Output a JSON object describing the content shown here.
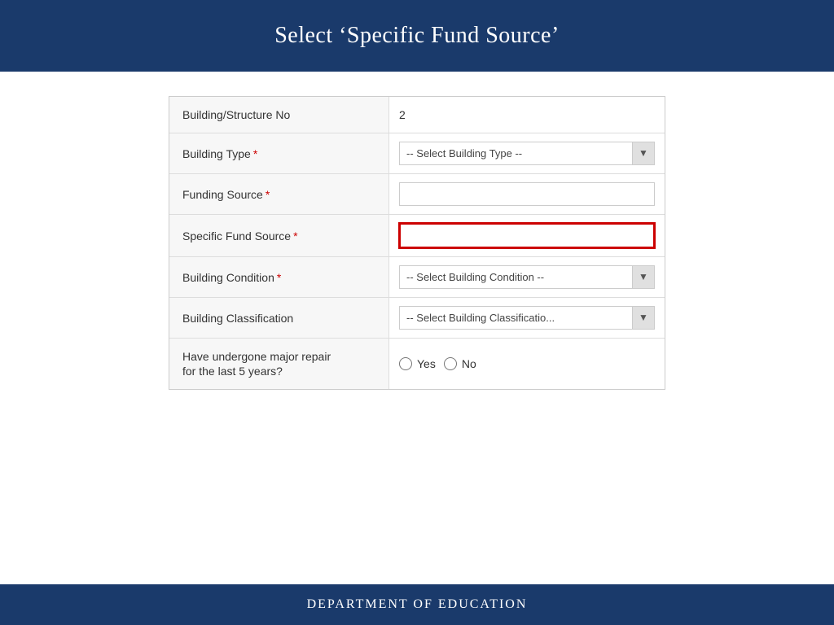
{
  "header": {
    "title": "Select ‘Specific Fund Source’"
  },
  "footer": {
    "title": "Department of Education"
  },
  "form": {
    "rows": [
      {
        "id": "building-structure-no",
        "label": "Building/Structure No",
        "required": false,
        "type": "static",
        "value": "2"
      },
      {
        "id": "building-type",
        "label": "Building Type",
        "required": true,
        "type": "select",
        "placeholder": "-- Select Building Type --",
        "options": [
          "-- Select Building Type --"
        ]
      },
      {
        "id": "funding-source",
        "label": "Funding Source",
        "required": true,
        "type": "text",
        "value": "",
        "placeholder": ""
      },
      {
        "id": "specific-fund-source",
        "label": "Specific Fund Source",
        "required": true,
        "type": "text-highlighted",
        "value": "",
        "placeholder": ""
      },
      {
        "id": "building-condition",
        "label": "Building Condition",
        "required": true,
        "type": "select",
        "placeholder": "-- Select Building Condition --",
        "options": [
          "-- Select Building Condition --"
        ]
      },
      {
        "id": "building-classification",
        "label": "Building Classification",
        "required": false,
        "type": "select",
        "placeholder": "-- Select Building Classificatio...",
        "options": [
          "-- Select Building Classificatio..."
        ]
      },
      {
        "id": "major-repair",
        "label_line1": "Have undergone major repair",
        "label_line2": "for the last 5 years?",
        "required": false,
        "type": "radio",
        "options": [
          "Yes",
          "No"
        ]
      }
    ]
  },
  "labels": {
    "required_marker": "*",
    "yes": "Yes",
    "no": "No"
  }
}
